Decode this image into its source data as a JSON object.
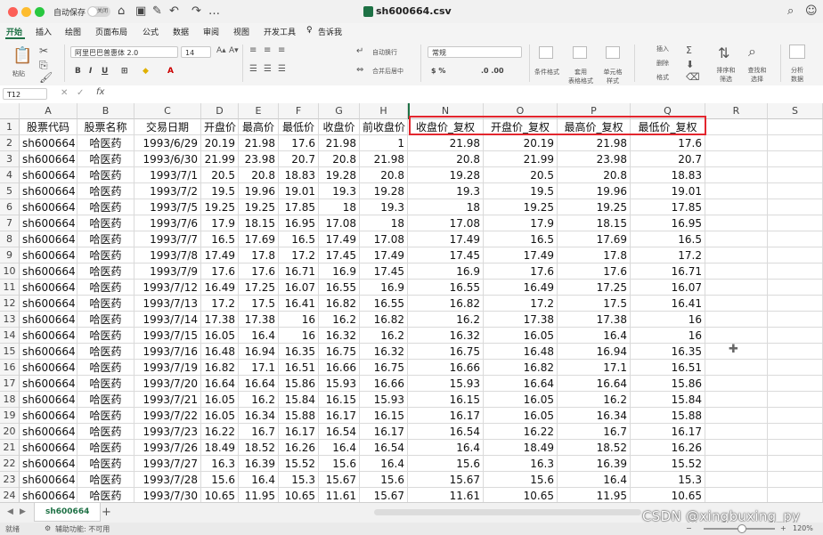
{
  "titlebar": {
    "autosave_label": "自动保存",
    "autosave_state": "关闭",
    "filename": "sh600664.csv"
  },
  "ribbon_tabs": [
    "开始",
    "插入",
    "绘图",
    "页面布局",
    "公式",
    "数据",
    "审阅",
    "视图",
    "开发工具",
    "告诉我"
  ],
  "ribbon_right": {
    "share_label": "共享",
    "comment_label": "批注"
  },
  "ribbon": {
    "paste_label": "粘贴",
    "font_name": "阿里巴巴普惠体 2.0",
    "font_size": "14",
    "wrap_text_label": "自动换行",
    "merge_center_label": "合并后居中",
    "number_format": "常规",
    "conditional_format_label": "条件格式",
    "table_format_label": "套用\n表格格式",
    "cell_style_label": "单元格\n样式",
    "insert_label": "插入",
    "delete_label": "删除",
    "format_label": "格式",
    "sort_filter_label": "排序和\n筛选",
    "find_select_label": "查找和\n选择",
    "analyze_label": "分析\n数据"
  },
  "formula_bar": {
    "name_box": "T12",
    "fx": "fx",
    "formula": ""
  },
  "columns": [
    "A",
    "B",
    "C",
    "D",
    "E",
    "F",
    "G",
    "H",
    "N",
    "O",
    "P",
    "Q",
    "R",
    "S"
  ],
  "header_row": [
    "股票代码",
    "股票名称",
    "交易日期",
    "开盘价",
    "最高价",
    "最低价",
    "收盘价",
    "前收盘价",
    "收盘价_复权",
    "开盘价_复权",
    "最高价_复权",
    "最低价_复权",
    "",
    ""
  ],
  "rows": [
    [
      "sh600664",
      "哈医药",
      "1993/6/29",
      "20.19",
      "21.98",
      "17.6",
      "21.98",
      "1",
      "21.98",
      "20.19",
      "21.98",
      "17.6"
    ],
    [
      "sh600664",
      "哈医药",
      "1993/6/30",
      "21.99",
      "23.98",
      "20.7",
      "20.8",
      "21.98",
      "20.8",
      "21.99",
      "23.98",
      "20.7"
    ],
    [
      "sh600664",
      "哈医药",
      "1993/7/1",
      "20.5",
      "20.8",
      "18.83",
      "19.28",
      "20.8",
      "19.28",
      "20.5",
      "20.8",
      "18.83"
    ],
    [
      "sh600664",
      "哈医药",
      "1993/7/2",
      "19.5",
      "19.96",
      "19.01",
      "19.3",
      "19.28",
      "19.3",
      "19.5",
      "19.96",
      "19.01"
    ],
    [
      "sh600664",
      "哈医药",
      "1993/7/5",
      "19.25",
      "19.25",
      "17.85",
      "18",
      "19.3",
      "18",
      "19.25",
      "19.25",
      "17.85"
    ],
    [
      "sh600664",
      "哈医药",
      "1993/7/6",
      "17.9",
      "18.15",
      "16.95",
      "17.08",
      "18",
      "17.08",
      "17.9",
      "18.15",
      "16.95"
    ],
    [
      "sh600664",
      "哈医药",
      "1993/7/7",
      "16.5",
      "17.69",
      "16.5",
      "17.49",
      "17.08",
      "17.49",
      "16.5",
      "17.69",
      "16.5"
    ],
    [
      "sh600664",
      "哈医药",
      "1993/7/8",
      "17.49",
      "17.8",
      "17.2",
      "17.45",
      "17.49",
      "17.45",
      "17.49",
      "17.8",
      "17.2"
    ],
    [
      "sh600664",
      "哈医药",
      "1993/7/9",
      "17.6",
      "17.6",
      "16.71",
      "16.9",
      "17.45",
      "16.9",
      "17.6",
      "17.6",
      "16.71"
    ],
    [
      "sh600664",
      "哈医药",
      "1993/7/12",
      "16.49",
      "17.25",
      "16.07",
      "16.55",
      "16.9",
      "16.55",
      "16.49",
      "17.25",
      "16.07"
    ],
    [
      "sh600664",
      "哈医药",
      "1993/7/13",
      "17.2",
      "17.5",
      "16.41",
      "16.82",
      "16.55",
      "16.82",
      "17.2",
      "17.5",
      "16.41"
    ],
    [
      "sh600664",
      "哈医药",
      "1993/7/14",
      "17.38",
      "17.38",
      "16",
      "16.2",
      "16.82",
      "16.2",
      "17.38",
      "17.38",
      "16"
    ],
    [
      "sh600664",
      "哈医药",
      "1993/7/15",
      "16.05",
      "16.4",
      "16",
      "16.32",
      "16.2",
      "16.32",
      "16.05",
      "16.4",
      "16"
    ],
    [
      "sh600664",
      "哈医药",
      "1993/7/16",
      "16.48",
      "16.94",
      "16.35",
      "16.75",
      "16.32",
      "16.75",
      "16.48",
      "16.94",
      "16.35"
    ],
    [
      "sh600664",
      "哈医药",
      "1993/7/19",
      "16.82",
      "17.1",
      "16.51",
      "16.66",
      "16.75",
      "16.66",
      "16.82",
      "17.1",
      "16.51"
    ],
    [
      "sh600664",
      "哈医药",
      "1993/7/20",
      "16.64",
      "16.64",
      "15.86",
      "15.93",
      "16.66",
      "15.93",
      "16.64",
      "16.64",
      "15.86"
    ],
    [
      "sh600664",
      "哈医药",
      "1993/7/21",
      "16.05",
      "16.2",
      "15.84",
      "16.15",
      "15.93",
      "16.15",
      "16.05",
      "16.2",
      "15.84"
    ],
    [
      "sh600664",
      "哈医药",
      "1993/7/22",
      "16.05",
      "16.34",
      "15.88",
      "16.17",
      "16.15",
      "16.17",
      "16.05",
      "16.34",
      "15.88"
    ],
    [
      "sh600664",
      "哈医药",
      "1993/7/23",
      "16.22",
      "16.7",
      "16.17",
      "16.54",
      "16.17",
      "16.54",
      "16.22",
      "16.7",
      "16.17"
    ],
    [
      "sh600664",
      "哈医药",
      "1993/7/26",
      "18.49",
      "18.52",
      "16.26",
      "16.4",
      "16.54",
      "16.4",
      "18.49",
      "18.52",
      "16.26"
    ],
    [
      "sh600664",
      "哈医药",
      "1993/7/27",
      "16.3",
      "16.39",
      "15.52",
      "15.6",
      "16.4",
      "15.6",
      "16.3",
      "16.39",
      "15.52"
    ],
    [
      "sh600664",
      "哈医药",
      "1993/7/28",
      "15.6",
      "16.4",
      "15.3",
      "15.67",
      "15.6",
      "15.67",
      "15.6",
      "16.4",
      "15.3"
    ],
    [
      "sh600664",
      "哈医药",
      "1993/7/30",
      "10.65",
      "11.95",
      "10.65",
      "11.61",
      "15.67",
      "11.61",
      "10.65",
      "11.95",
      "10.65"
    ]
  ],
  "sheet_tab": "sh600664",
  "statusbar": {
    "ready": "就绪",
    "accessibility": "辅助功能: 不可用",
    "zoom": "120%"
  },
  "watermark": "CSDN @xingbuxing_py"
}
